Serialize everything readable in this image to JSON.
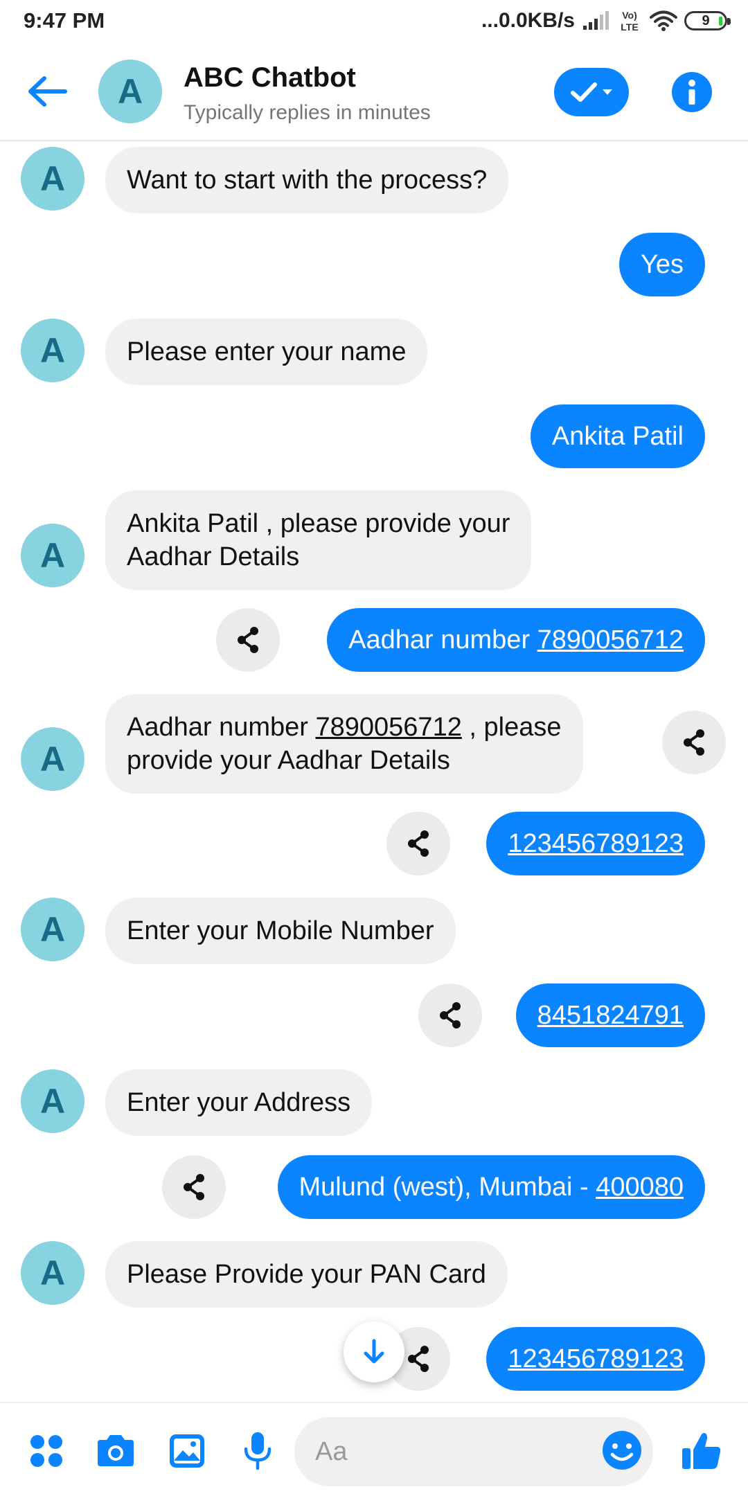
{
  "status_bar": {
    "time": "9:47 PM",
    "network_speed": "...0.0KB/s",
    "battery_level": "9",
    "volte_label_top": "Vo)",
    "volte_label_bottom": "LTE"
  },
  "header": {
    "avatar_letter": "A",
    "title": "ABC Chatbot",
    "subtitle": "Typically replies in minutes",
    "accent_color": "#0a84ff"
  },
  "messages": [
    {
      "from": "bot",
      "avatar_letter": "A",
      "text": "Want to start with the process?"
    },
    {
      "from": "user",
      "text": "Yes"
    },
    {
      "from": "bot",
      "avatar_letter": "A",
      "text": "Please enter your name"
    },
    {
      "from": "user",
      "text": "Ankita Patil"
    },
    {
      "from": "bot",
      "avatar_letter": "A",
      "line1": "Ankita Patil , please provide your",
      "line2": "Aadhar Details"
    },
    {
      "from": "user",
      "prefix": "Aadhar number ",
      "link": "7890056712"
    },
    {
      "from": "bot",
      "avatar_letter": "A",
      "prefix": "Aadhar number ",
      "link": "7890056712",
      "suffix": " , please",
      "line2": "provide your Aadhar Details"
    },
    {
      "from": "user",
      "link": "123456789123"
    },
    {
      "from": "bot",
      "avatar_letter": "A",
      "text": "Enter your Mobile Number"
    },
    {
      "from": "user",
      "link": "8451824791"
    },
    {
      "from": "bot",
      "avatar_letter": "A",
      "text": "Enter your Address"
    },
    {
      "from": "user",
      "prefix": "Mulund (west), Mumbai - ",
      "link": "400080"
    },
    {
      "from": "bot",
      "avatar_letter": "A",
      "text": "Please Provide your PAN Card"
    },
    {
      "from": "user",
      "link": "123456789123"
    }
  ],
  "composer": {
    "placeholder": "Aa",
    "icons": [
      "apps-icon",
      "camera-icon",
      "gallery-icon",
      "microphone-icon",
      "emoji-icon",
      "thumbs-up-icon"
    ]
  }
}
